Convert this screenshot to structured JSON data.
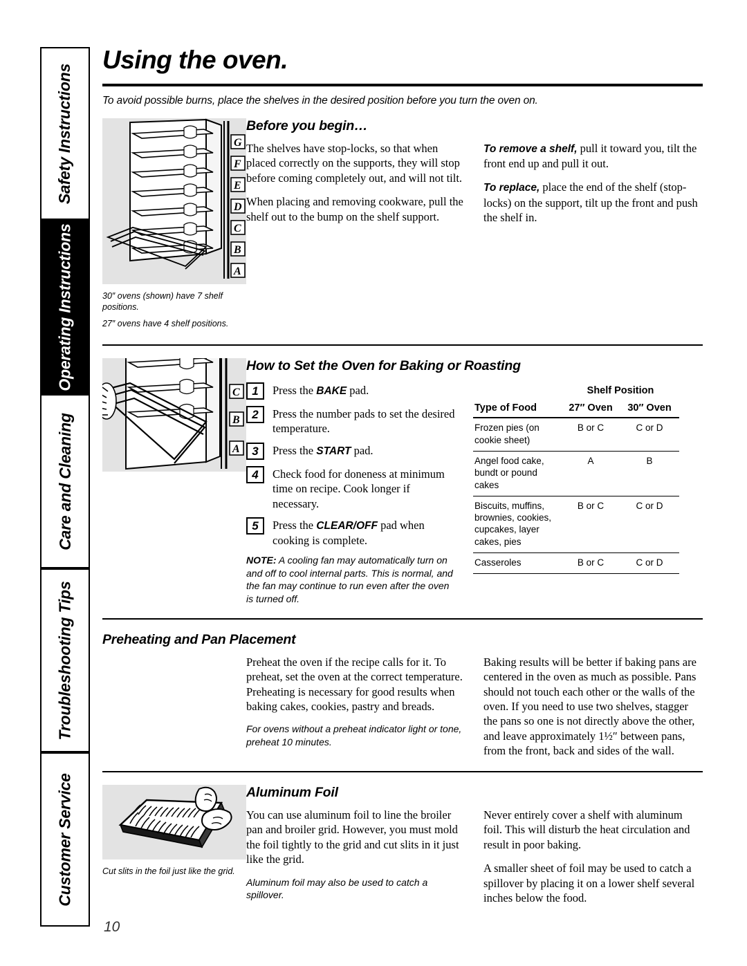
{
  "sidebar": {
    "tabs": [
      {
        "label": "Safety Instructions",
        "active": false
      },
      {
        "label": "Operating Instructions",
        "active": true
      },
      {
        "label": "Care and Cleaning",
        "active": false
      },
      {
        "label": "Troubleshooting Tips",
        "active": false
      },
      {
        "label": "Customer Service",
        "active": false
      }
    ]
  },
  "page": {
    "title": "Using the oven.",
    "subtitle": "To avoid possible burns, place the shelves in the desired position before you turn the oven on.",
    "number": "10"
  },
  "before_you_begin": {
    "heading": "Before you begin…",
    "figure": {
      "shelf_labels": [
        "G",
        "F",
        "E",
        "D",
        "C",
        "B",
        "A"
      ],
      "caption_1": "30″ ovens (shown) have 7 shelf positions.",
      "caption_2": "27″ ovens have 4 shelf positions."
    },
    "left_paragraphs": [
      "The shelves have stop-locks, so that when placed correctly on the supports, they will stop before coming completely out, and will not tilt.",
      "When placing and removing cookware, pull the shelf out to the bump on the shelf support."
    ],
    "right_paragraphs": [
      {
        "lead": "To remove a shelf,",
        "text": " pull it toward you, tilt the front end up and pull it out."
      },
      {
        "lead": "To replace,",
        "text": " place the end of the shelf (stop-locks) on the support, tilt up the front and push the shelf in."
      }
    ]
  },
  "baking": {
    "heading": "How to Set the Oven for Baking or Roasting",
    "figure": {
      "shelf_labels": [
        "C",
        "B",
        "A"
      ]
    },
    "steps": [
      {
        "num": "1",
        "pre": "Press the ",
        "bold": "BAKE",
        "post": " pad."
      },
      {
        "num": "2",
        "pre": "Press the number pads to set the desired temperature.",
        "bold": "",
        "post": ""
      },
      {
        "num": "3",
        "pre": "Press the ",
        "bold": "START",
        "post": " pad."
      },
      {
        "num": "4",
        "pre": "Check food for doneness at minimum time on recipe. Cook longer if necessary.",
        "bold": "",
        "post": ""
      },
      {
        "num": "5",
        "pre": "Press the ",
        "bold": "CLEAR/OFF",
        "post": " pad when cooking is complete."
      }
    ],
    "note_label": "NOTE:",
    "note_text": " A cooling fan may automatically turn on and off to cool internal parts. This is normal, and the fan may continue to run even after the oven is turned off.",
    "table": {
      "span_header": "Shelf Position",
      "headers": [
        "Type of Food",
        "27″ Oven",
        "30″ Oven"
      ],
      "rows": [
        {
          "food": "Frozen pies (on cookie sheet)",
          "oven27": "B or C",
          "oven30": "C or D"
        },
        {
          "food": "Angel food cake, bundt or pound cakes",
          "oven27": "A",
          "oven30": "B"
        },
        {
          "food": "Biscuits, muffins, brownies, cookies, cupcakes, layer cakes, pies",
          "oven27": "B or C",
          "oven30": "C or D"
        },
        {
          "food": "Casseroles",
          "oven27": "B or C",
          "oven30": "C or D"
        }
      ]
    }
  },
  "preheating": {
    "heading": "Preheating and Pan Placement",
    "left_paragraph": "Preheat the oven if the recipe calls for it. To preheat, set the oven at the correct temperature. Preheating is necessary for good results when baking cakes, cookies, pastry and breads.",
    "left_note": "For ovens without a preheat indicator light or tone, preheat 10 minutes.",
    "right_paragraph": "Baking results will be better if baking pans are centered in the oven as much as possible. Pans should not touch each other or the walls of the oven. If you need to use two shelves, stagger the pans so one is not directly above the other, and leave approximately 1½″ between pans, from the front, back and sides of the wall."
  },
  "aluminum_foil": {
    "heading": "Aluminum Foil",
    "figure_caption": "Cut slits in the foil just like the grid.",
    "left_paragraph": "You can use aluminum foil to line the broiler pan and broiler grid. However, you must mold the foil tightly to the grid and cut slits in it just like the grid.",
    "left_note": "Aluminum foil may also be used to catch a spillover.",
    "right_paragraphs": [
      "Never entirely cover a shelf with aluminum foil. This will disturb the heat circulation and result in poor baking.",
      "A smaller sheet of foil may be used to catch a spillover by placing it on a lower shelf several inches below the food."
    ]
  }
}
